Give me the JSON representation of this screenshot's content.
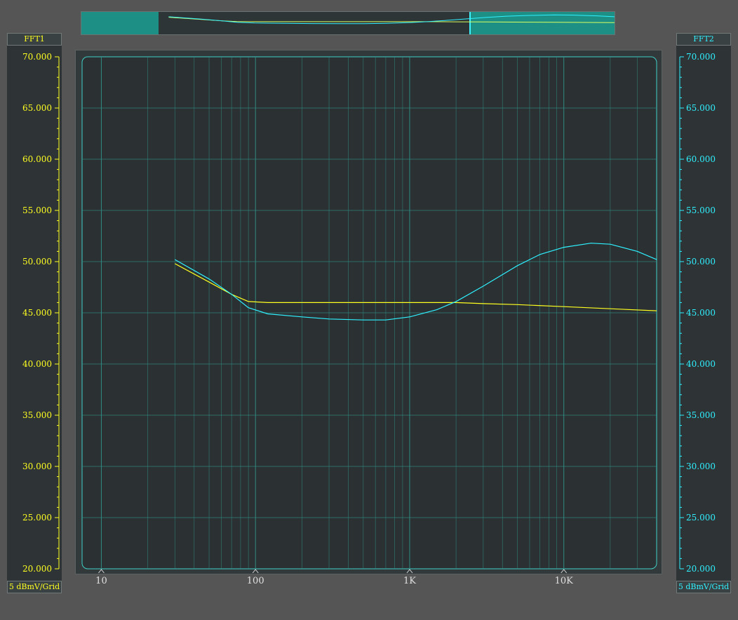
{
  "axes": {
    "left": {
      "title": "FFT1",
      "unit_label": "5 dBmV/Grid",
      "color": "#ffff20"
    },
    "right": {
      "title": "FFT2",
      "unit_label": "5 dBmV/Grid",
      "color": "#2ff0ff"
    }
  },
  "colors": {
    "grid": "#2f8f86",
    "plot_bg": "#2b3032",
    "border": "#3fd0c8",
    "x_tick_text": "#e0e0e0"
  },
  "chart_data": {
    "type": "line",
    "x_scale": "log",
    "xlim": [
      7.5,
      40000
    ],
    "ylim": [
      20,
      70
    ],
    "y_ticks": [
      20,
      25,
      30,
      35,
      40,
      45,
      50,
      55,
      60,
      65,
      70
    ],
    "y_tick_labels": [
      "20.000",
      "25.000",
      "30.000",
      "35.000",
      "40.000",
      "45.000",
      "50.000",
      "55.000",
      "60.000",
      "65.000",
      "70.000"
    ],
    "x_ticks": [
      10,
      100,
      1000,
      10000
    ],
    "x_tick_labels": [
      "10",
      "100",
      "1K",
      "10K"
    ],
    "grid": true,
    "series": [
      {
        "name": "FFT1",
        "color": "#ffff20",
        "x": [
          30,
          50,
          70,
          90,
          120,
          200,
          500,
          1000,
          2000,
          3000,
          5000,
          10000,
          20000,
          40000
        ],
        "y": [
          49.8,
          48.0,
          46.8,
          46.1,
          46.0,
          46.0,
          46.0,
          46.0,
          46.0,
          45.9,
          45.8,
          45.6,
          45.4,
          45.2
        ]
      },
      {
        "name": "FFT2",
        "color": "#2ff0ff",
        "x": [
          30,
          50,
          70,
          90,
          120,
          200,
          300,
          500,
          700,
          1000,
          1500,
          2000,
          3000,
          5000,
          7000,
          10000,
          15000,
          20000,
          30000,
          40000
        ],
        "y": [
          50.2,
          48.3,
          46.8,
          45.5,
          44.9,
          44.6,
          44.4,
          44.3,
          44.3,
          44.6,
          45.3,
          46.1,
          47.6,
          49.6,
          50.7,
          51.4,
          51.8,
          51.7,
          51.0,
          50.2
        ]
      }
    ]
  }
}
